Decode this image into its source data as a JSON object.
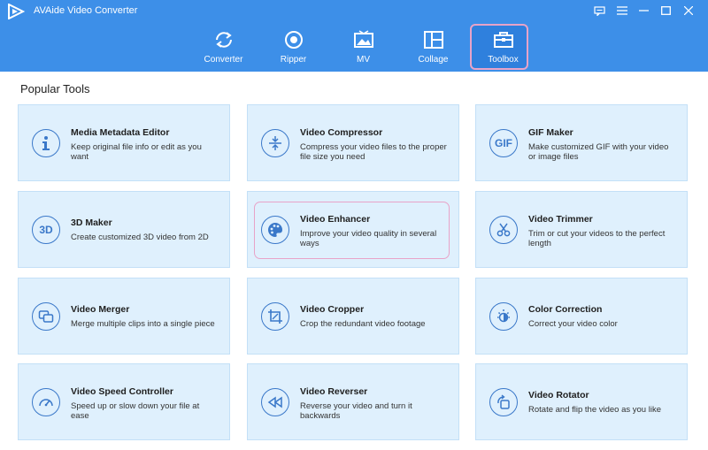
{
  "app": {
    "title": "AVAide Video Converter"
  },
  "nav": {
    "items": [
      {
        "label": "Converter",
        "icon": "converter-icon"
      },
      {
        "label": "Ripper",
        "icon": "ripper-icon"
      },
      {
        "label": "MV",
        "icon": "mv-icon"
      },
      {
        "label": "Collage",
        "icon": "collage-icon"
      },
      {
        "label": "Toolbox",
        "icon": "toolbox-icon",
        "active": true
      }
    ]
  },
  "section": {
    "title": "Popular Tools"
  },
  "tools": [
    {
      "title": "Media Metadata Editor",
      "desc": "Keep original file info or edit as you want",
      "icon": "info-icon"
    },
    {
      "title": "Video Compressor",
      "desc": "Compress your video files to the proper file size you need",
      "icon": "compress-icon"
    },
    {
      "title": "GIF Maker",
      "desc": "Make customized GIF with your video or image files",
      "icon": "gif-icon",
      "icon_text": "GIF"
    },
    {
      "title": "3D Maker",
      "desc": "Create customized 3D video from 2D",
      "icon": "3d-icon",
      "icon_text": "3D"
    },
    {
      "title": "Video Enhancer",
      "desc": "Improve your video quality in several ways",
      "icon": "palette-icon"
    },
    {
      "title": "Video Trimmer",
      "desc": "Trim or cut your videos to the perfect length",
      "icon": "scissors-icon"
    },
    {
      "title": "Video Merger",
      "desc": "Merge multiple clips into a single piece",
      "icon": "merge-icon"
    },
    {
      "title": "Video Cropper",
      "desc": "Crop the redundant video footage",
      "icon": "crop-icon"
    },
    {
      "title": "Color Correction",
      "desc": "Correct your video color",
      "icon": "color-correction-icon"
    },
    {
      "title": "Video Speed Controller",
      "desc": "Speed up or slow down your file at ease",
      "icon": "speedometer-icon"
    },
    {
      "title": "Video Reverser",
      "desc": "Reverse your video and turn it backwards",
      "icon": "rewind-icon"
    },
    {
      "title": "Video Rotator",
      "desc": "Rotate and flip the video as you like",
      "icon": "rotate-icon"
    }
  ],
  "colors": {
    "topbar": "#3d8fe8",
    "card_bg": "#dff0fd",
    "icon": "#3a78c9",
    "highlight": "#e8a3c8"
  }
}
